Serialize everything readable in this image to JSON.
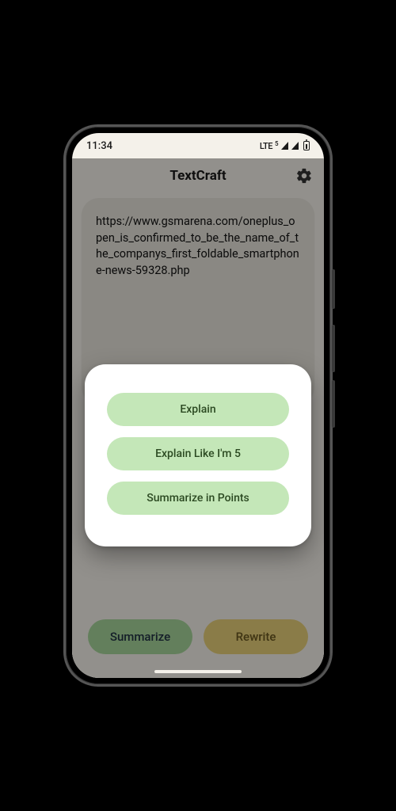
{
  "statusbar": {
    "time": "11:34",
    "network": "LTE"
  },
  "app": {
    "title": "TextCraft"
  },
  "card": {
    "text": "https://www.gsmarena.com/oneplus_open_is_confirmed_to_be_the_name_of_the_companys_first_foldable_smartphone-news-59328.php"
  },
  "actions": {
    "summarize": "Summarize",
    "rewrite": "Rewrite"
  },
  "popup": {
    "options": [
      {
        "label": "Explain"
      },
      {
        "label": "Explain Like I'm 5"
      },
      {
        "label": "Summarize in Points"
      }
    ]
  }
}
